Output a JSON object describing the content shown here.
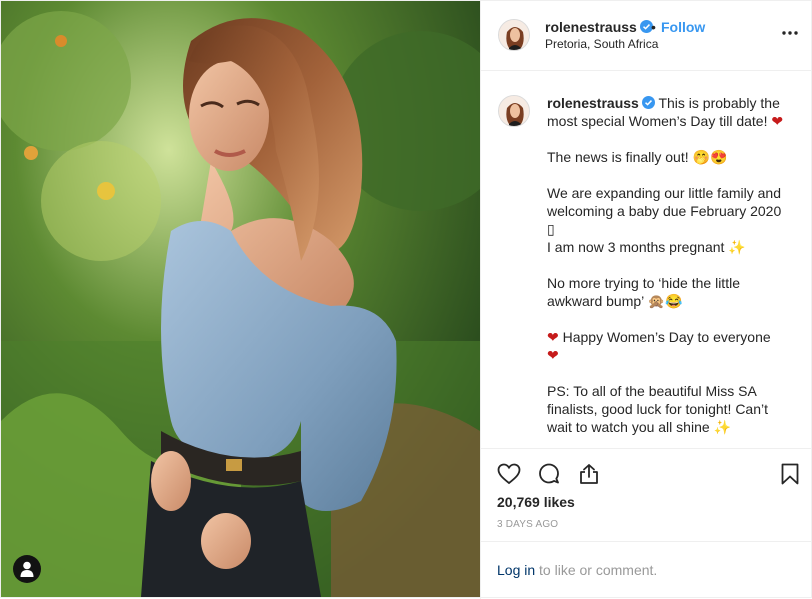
{
  "post": {
    "username": "rolenestrauss",
    "verified": true,
    "follow_separator": "•",
    "follow_label": "Follow",
    "location": "Pretoria, South Africa",
    "more_icon": "more-horizontal-icon",
    "caption_lines": [
      "This is probably the",
      "most special Women’s Day till date! ❤",
      "",
      "The news is finally out! 🤭😍",
      "",
      "We are expanding our little family and",
      "welcoming a baby due February 2020",
      "▯",
      "I am now 3 months pregnant ✨",
      "",
      "No more trying to ‘hide the little",
      "awkward bump’ 🙊😂",
      "",
      "❤ Happy Women’s Day to everyone",
      "❤",
      "",
      "PS: To all of the beautiful Miss SA",
      "finalists, good luck for tonight! Can’t",
      "wait to watch you all shine ✨"
    ],
    "actions": {
      "like_icon": "heart-outline-icon",
      "comment_icon": "comment-bubble-icon",
      "share_icon": "share-upload-icon",
      "save_icon": "bookmark-icon"
    },
    "likes": "20,769 likes",
    "time_ago": "3 DAYS AGO",
    "comment": {
      "login_text": "Log in",
      "rest_text": " to like or comment."
    },
    "colors": {
      "accent": "#3897f0",
      "heart": "#c61b1b",
      "muted": "#999999",
      "text": "#262626"
    }
  }
}
